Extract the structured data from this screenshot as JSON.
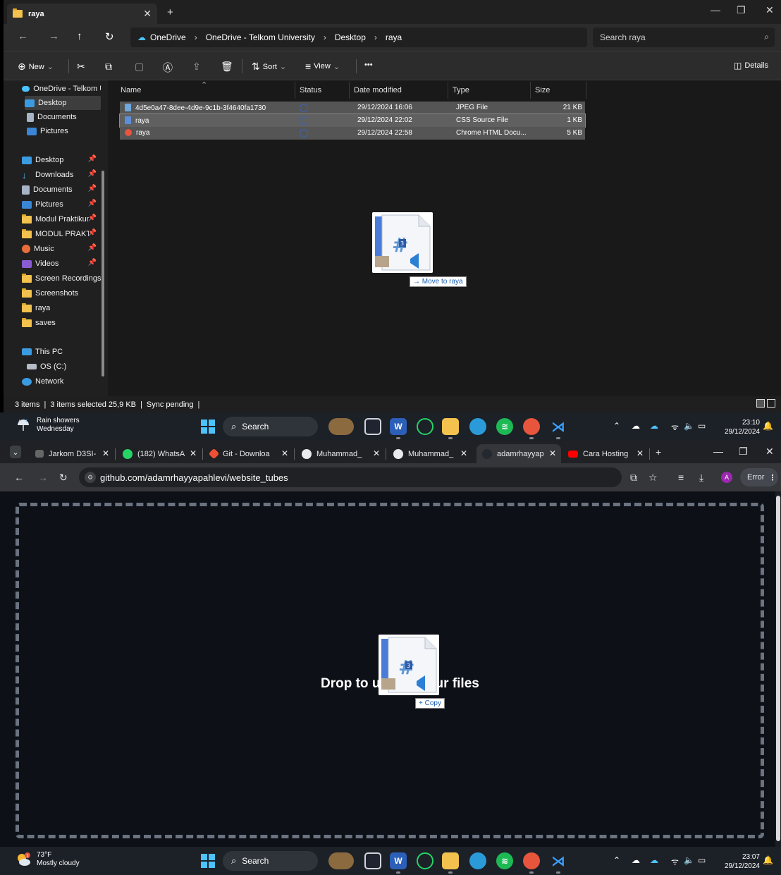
{
  "explorer": {
    "tab_title": "raya",
    "breadcrumb": [
      "OneDrive",
      "OneDrive - Telkom University",
      "Desktop",
      "raya"
    ],
    "search_placeholder": "Search raya",
    "toolbar": {
      "new": "New",
      "sort": "Sort",
      "view": "View",
      "more": "•••",
      "details": "Details"
    },
    "sidebar": {
      "root": "OneDrive - Telkom U",
      "sub": [
        "Desktop",
        "Documents",
        "Pictures"
      ],
      "quick": [
        "Desktop",
        "Downloads",
        "Documents",
        "Pictures",
        "Modul Praktikum",
        "MODUL PRAKTIK",
        "Music",
        "Videos",
        "Screen Recordings",
        "Screenshots",
        "raya",
        "saves"
      ],
      "system": [
        "This PC",
        "OS (C:)",
        "Network"
      ]
    },
    "columns": {
      "name": "Name",
      "status": "Status",
      "date": "Date modified",
      "type": "Type",
      "size": "Size"
    },
    "files": [
      {
        "name": "4d5e0a47-8dee-4d9e-9c1b-3f4640fa1730",
        "date": "29/12/2024 16:06",
        "type": "JPEG File",
        "size": "21 KB"
      },
      {
        "name": "raya",
        "date": "29/12/2024 22:02",
        "type": "CSS Source File",
        "size": "1 KB"
      },
      {
        "name": "raya",
        "date": "29/12/2024 22:58",
        "type": "Chrome HTML Docu...",
        "size": "5 KB"
      }
    ],
    "drag_badge": "3",
    "drag_tip": "Move to raya",
    "status": {
      "items": "3 items",
      "selected": "3 items selected  25,9 KB",
      "sync": "Sync pending"
    }
  },
  "taskbar_top": {
    "weather_title": "Rain showers",
    "weather_sub": "Wednesday",
    "search": "Search",
    "time": "23:10",
    "date": "29/12/2024"
  },
  "chrome": {
    "tabs": [
      "Jarkom D3SI-",
      "(182) WhatsA",
      "Git - Downloa",
      "Muhammad_",
      "Muhammad_",
      "adamrhayyap",
      "Cara Hosting"
    ],
    "url": "github.com/adamrhayyapahlevi/website_tubes",
    "error_label": "Error",
    "avatar_letter": "A",
    "drop_text": "Drop to upload your files",
    "drag_badge": "3",
    "drag_tip": "+ Copy"
  },
  "taskbar_bottom": {
    "weather_title": "73°F",
    "weather_sub": "Mostly cloudy",
    "search": "Search",
    "time": "23:07",
    "date": "29/12/2024"
  },
  "colors": {
    "explorer_bg": "#1f1f1f",
    "github_bg": "#0d1117",
    "taskbar": "#1c2027",
    "accent": "#4cc2ff"
  }
}
